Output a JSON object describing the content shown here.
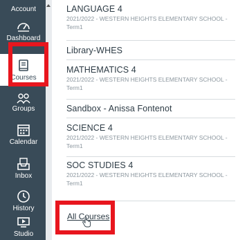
{
  "nav": {
    "account": "Account",
    "dashboard": "Dashboard",
    "courses": "Courses",
    "groups": "Groups",
    "calendar": "Calendar",
    "inbox": "Inbox",
    "history": "History",
    "studio": "Studio"
  },
  "courses": [
    {
      "name": "LANGUAGE 4",
      "meta": "2021/2022 - WESTERN HEIGHTS ELEMENTARY SCHOOL - Term1"
    },
    {
      "name": "Library-WHES",
      "meta": ""
    },
    {
      "name": "MATHEMATICS 4",
      "meta": "2021/2022 - WESTERN HEIGHTS ELEMENTARY SCHOOL - Term1"
    },
    {
      "name": "Sandbox - Anissa Fontenot",
      "meta": ""
    },
    {
      "name": "SCIENCE 4",
      "meta": "2021/2022 - WESTERN HEIGHTS ELEMENTARY SCHOOL - Term1"
    },
    {
      "name": "SOC STUDIES 4",
      "meta": "2021/2022 - WESTERN HEIGHTS ELEMENTARY SCHOOL - Term1"
    }
  ],
  "all_courses": "All Courses",
  "colors": {
    "nav_bg": "#394b58",
    "highlight": "#e8161e"
  }
}
